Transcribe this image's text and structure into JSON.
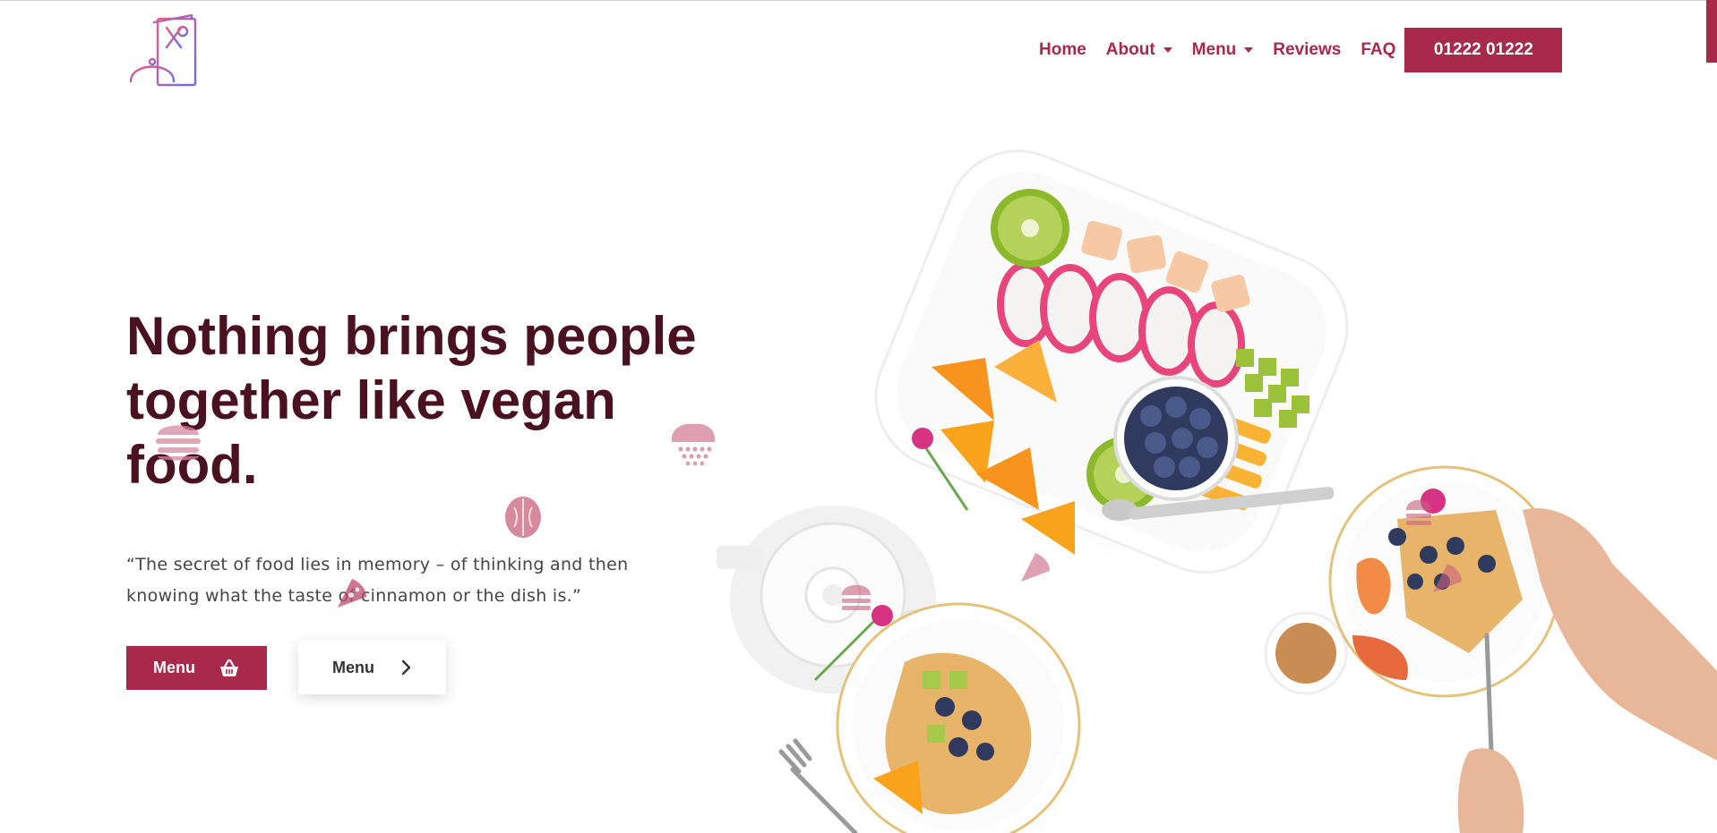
{
  "header": {
    "logo_icon": "restaurant-cloche-menu-icon",
    "nav": [
      {
        "label": "Home",
        "has_dropdown": false
      },
      {
        "label": "About",
        "has_dropdown": true
      },
      {
        "label": "Menu",
        "has_dropdown": true
      },
      {
        "label": "Reviews",
        "has_dropdown": false
      },
      {
        "label": "FAQ",
        "has_dropdown": false
      }
    ],
    "phone_label": "01222 01222"
  },
  "hero": {
    "headline_lines": [
      "Nothing brings people",
      "together like vegan",
      "food."
    ],
    "quote_lines": [
      "“The secret of food lies in memory – of thinking and then",
      "knowing what the taste of cinnamon or the dish is.”"
    ],
    "primary_button": {
      "label": "Menu",
      "icon": "basket-icon"
    },
    "secondary_button": {
      "label": "Menu",
      "icon": "chevron-right-icon"
    }
  },
  "colors": {
    "accent": "#a8294a",
    "heading": "#4a1120",
    "body_text": "#444444",
    "deco": "#c9627e"
  }
}
